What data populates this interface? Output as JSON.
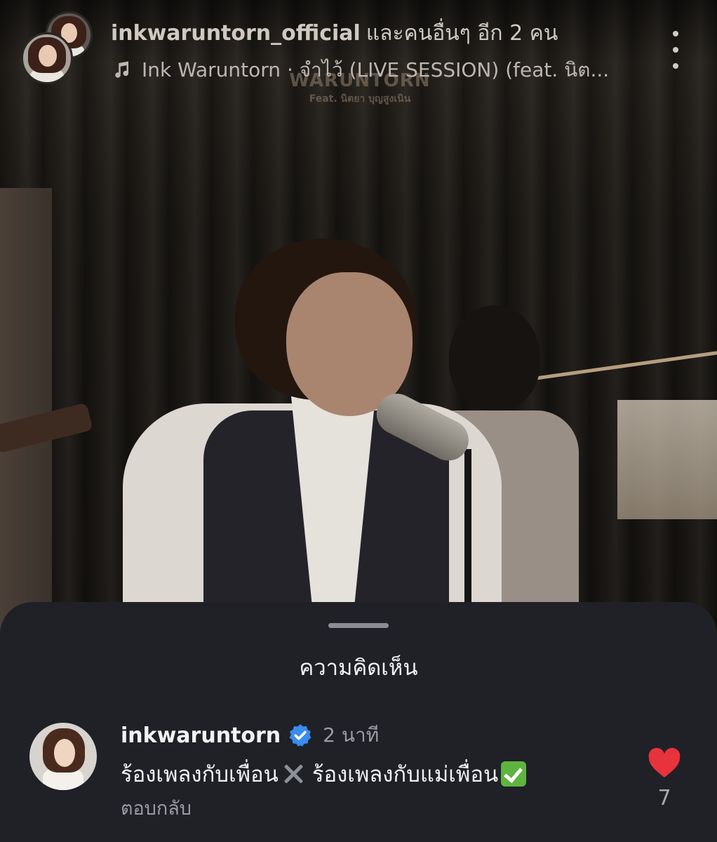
{
  "post": {
    "owner_name": "inkwaruntorn_official",
    "owner_rest": "และคนอื่นๆ อีก 2 คน",
    "music_icon": "music-note-icon",
    "music_title": "Ink Waruntorn · จำไว้ (LIVE SESSION) (feat. นิต..."
  },
  "video": {
    "brand_logo": "WARUNTORN",
    "brand_sub": "Feat. นิตยา บุญสูงเนิน"
  },
  "comments_sheet": {
    "title": "ความคิดเห็น",
    "comment": {
      "username": "inkwaruntorn",
      "verified": true,
      "time": "2 นาที",
      "text_part1": "ร้องเพลงกับเพื่อน",
      "text_part2": " ร้องเพลงกับแม่เพื่อน",
      "reply_label": "ตอบกลับ",
      "like_count": "7"
    }
  },
  "colors": {
    "sheet_bg": "#1f2127",
    "like_red": "#e8323c",
    "verified_blue": "#3a8cf0",
    "check_green": "#5fb33f"
  }
}
